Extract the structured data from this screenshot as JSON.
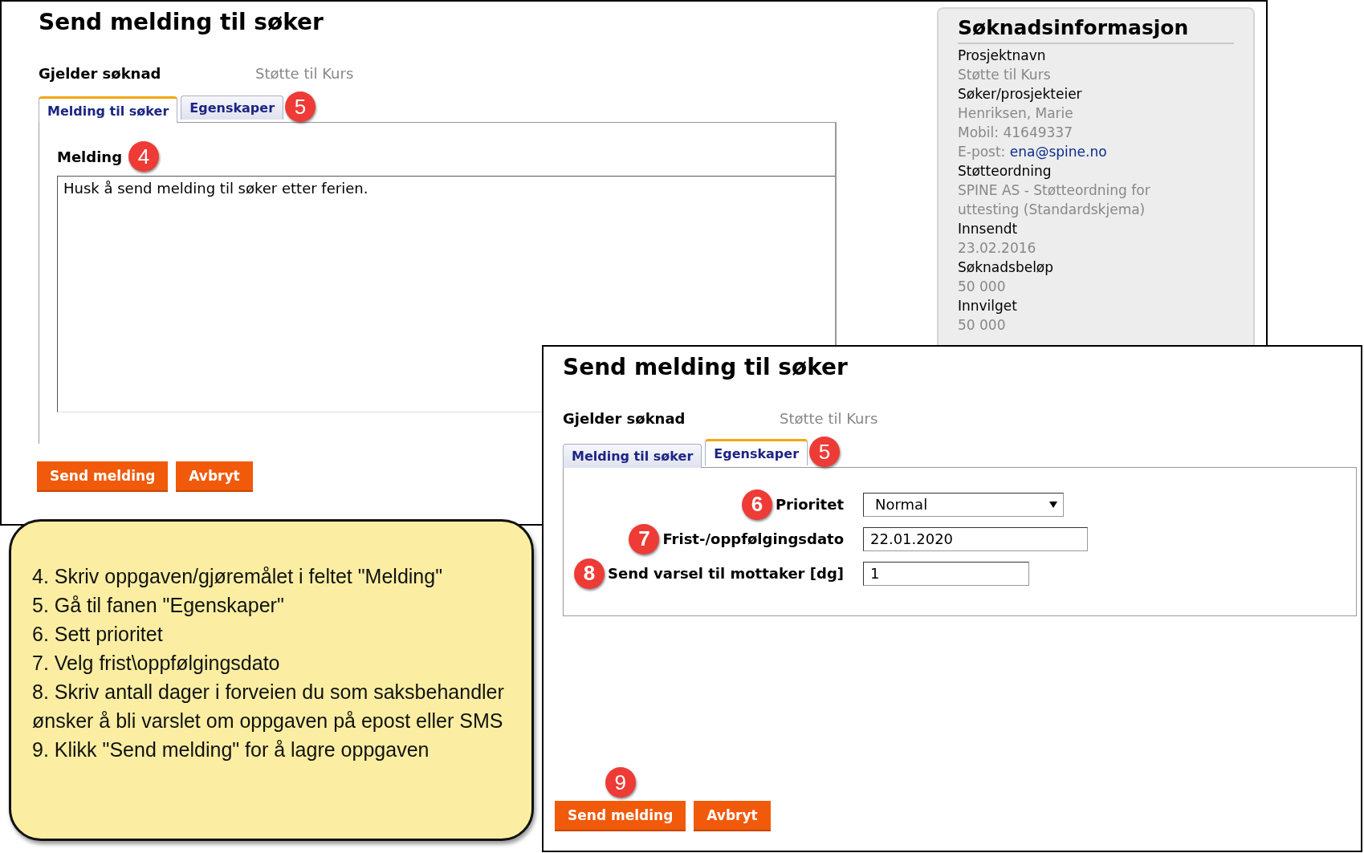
{
  "windows": [
    {
      "kind": "message",
      "title": "Send melding til søker",
      "applies_label": "Gjelder søknad",
      "applies_value": "Støtte til Kurs",
      "tabs": [
        {
          "label": "Melding til søker",
          "selected": true
        },
        {
          "label": "Egenskaper",
          "selected": false,
          "badge": "5"
        }
      ],
      "field": {
        "label": "Melding",
        "badge": "4",
        "value": "Husk å send melding til søker etter ferien."
      },
      "buttons": [
        {
          "label": "Send melding"
        },
        {
          "label": "Avbryt"
        }
      ],
      "info_panel": {
        "title": "Søknadsinformasjon",
        "rows": [
          {
            "kind": "label",
            "text": "Prosjektnavn"
          },
          {
            "kind": "value",
            "text": "Støtte til Kurs"
          },
          {
            "kind": "label",
            "text": "Søker/prosjekteier"
          },
          {
            "kind": "value",
            "text": "Henriksen, Marie"
          },
          {
            "kind": "value",
            "text": "Mobil: 41649337"
          },
          {
            "kind": "link",
            "text": "E-post:",
            "link": "ena@spine.no"
          },
          {
            "kind": "label",
            "text": "Støtteordning"
          },
          {
            "kind": "value",
            "text": "SPINE AS - Støtteordning for uttesting (Standardskjema)"
          },
          {
            "kind": "label",
            "text": "Innsendt"
          },
          {
            "kind": "value",
            "text": "23.02.2016"
          },
          {
            "kind": "label",
            "text": "Søknadsbeløp"
          },
          {
            "kind": "value",
            "text": "50 000"
          },
          {
            "kind": "label",
            "text": "Innvilget"
          },
          {
            "kind": "value",
            "text": "50 000"
          }
        ]
      }
    },
    {
      "kind": "properties",
      "title": "Send melding til søker",
      "applies_label": "Gjelder søknad",
      "applies_value": "Støtte til Kurs",
      "tabs": [
        {
          "label": "Melding til søker",
          "selected": false
        },
        {
          "label": "Egenskaper",
          "selected": true,
          "badge": "5"
        }
      ],
      "fields": [
        {
          "kind": "select",
          "badge": "6",
          "label": "Prioritet",
          "value": "Normal"
        },
        {
          "kind": "date",
          "badge": "7",
          "label": "Frist-/oppfølgingsdato",
          "value": "22.01.2020"
        },
        {
          "kind": "number",
          "badge": "8",
          "label": "Send varsel til mottaker [dg]",
          "value": "1"
        }
      ],
      "buttons": [
        {
          "label": "Send melding",
          "badge": "9"
        },
        {
          "label": "Avbryt"
        }
      ]
    }
  ],
  "callout": {
    "lines": [
      "4. Skriv oppgaven/gjøremålet i feltet \"Melding\"",
      "5. Gå til fanen \"Egenskaper\"",
      "6. Sett prioritet",
      "7. Velg frist\\oppfølgingsdato",
      "8. Skriv antall dager i forveien du som saksbehandler ønsker å bli varslet om oppgaven på epost eller SMS",
      "9. Klikk \"Send melding\" for å lagre oppgaven"
    ]
  }
}
